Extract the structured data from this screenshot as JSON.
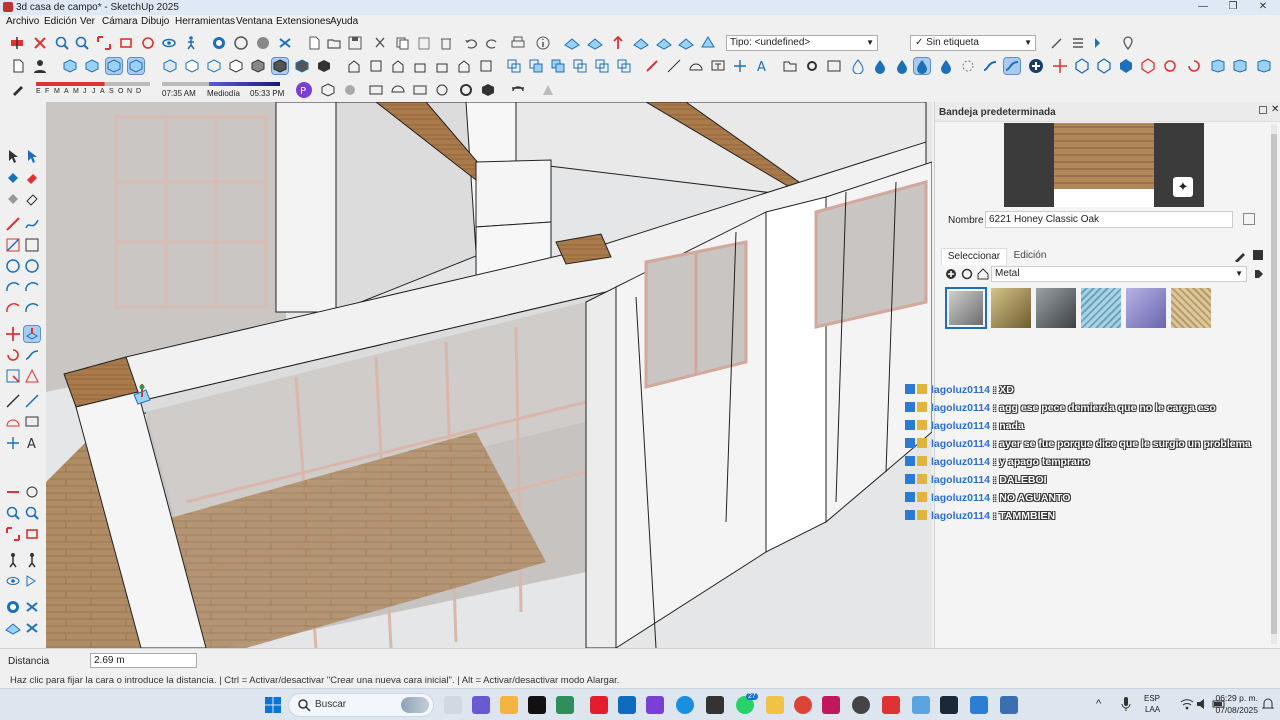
{
  "window": {
    "title": "3d casa de campo* - SketchUp 2025",
    "minimize": "—",
    "maximize": "❐",
    "close": "✕"
  },
  "menu": [
    "Archivo",
    "Edición",
    "Ver",
    "Cámara",
    "Dibujo",
    "Herramientas",
    "Ventana",
    "Extensiones",
    "Ayuda"
  ],
  "toolbar": {
    "tag_dropdown": "Tipo: <undefined>",
    "label_dropdown": "Sin etiqueta",
    "label_check": "✓",
    "months": [
      "E",
      "F",
      "M",
      "A",
      "M",
      "J",
      "J",
      "A",
      "S",
      "O",
      "N",
      "D"
    ],
    "time_start": "07:35 AM",
    "time_mid": "Mediodía",
    "time_end": "05:33 PM"
  },
  "tray": {
    "title": "Bandeja predeterminada",
    "name_label": "Nombre",
    "material_name": "6221 Honey Classic Oak",
    "tabs": [
      "Seleccionar",
      "Edición"
    ],
    "library": "Metal",
    "swatch_colors": [
      "#8a8a8a",
      "#8f7f45",
      "#5c6266",
      "#7fb2c8",
      "#8b86c6",
      "#c8b280"
    ]
  },
  "chat": [
    {
      "user": "lagoluz0114",
      "msg": " : XD"
    },
    {
      "user": "lagoluz0114",
      "msg": " : agg ese pece demierda que no le carga eso"
    },
    {
      "user": "lagoluz0114",
      "msg": " : nada"
    },
    {
      "user": "lagoluz0114",
      "msg": " : ayer se fue porque dice que le surgio un problema"
    },
    {
      "user": "lagoluz0114",
      "msg": " : y apago temprano"
    },
    {
      "user": "lagoluz0114",
      "msg": " : DALEBOI"
    },
    {
      "user": "lagoluz0114",
      "msg": " : NO AGUANTO"
    },
    {
      "user": "lagoluz0114",
      "msg": " : TAMMBIEN"
    }
  ],
  "measurements": {
    "label": "Distancia",
    "value": "2.69 m"
  },
  "status": "Haz clic para fijar la cara o introduce la distancia. | Ctrl = Activar/desactivar \"Crear una nueva cara inicial\". | Alt = Activar/desactivar modo Alargar.",
  "taskbar": {
    "search_placeholder": "Buscar",
    "language": "ESP",
    "keyboard": "LAA",
    "time": "06:29 p. m.",
    "date": "07/08/2025",
    "whatsapp_badge": "27"
  }
}
